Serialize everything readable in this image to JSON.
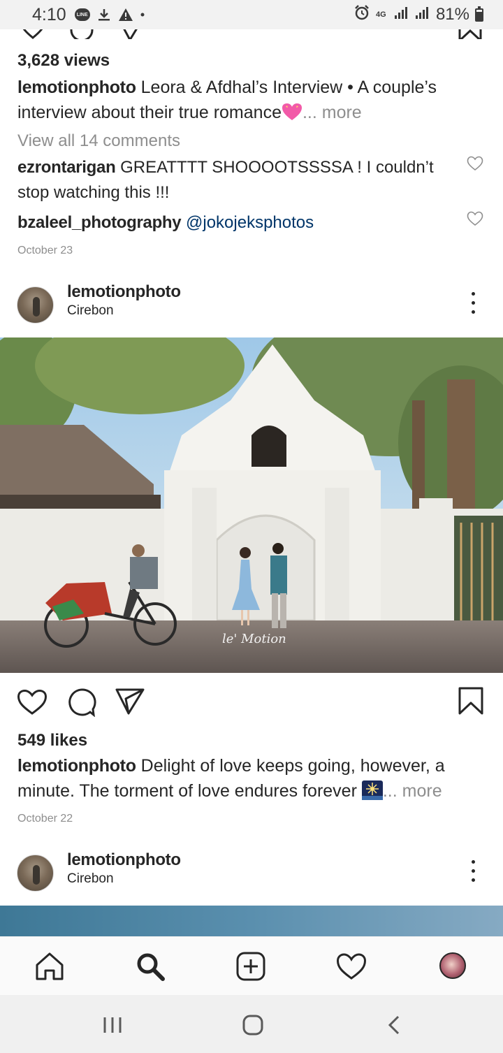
{
  "status_bar": {
    "time": "4:10",
    "left_icons": [
      "line-notification-icon",
      "download-icon",
      "warning-icon",
      "dot-icon"
    ],
    "right_icons": [
      "alarm-icon",
      "4g-icon",
      "signal-icon",
      "signal-icon",
      "battery-icon"
    ],
    "network": "4G",
    "battery_percent": "81%"
  },
  "post1": {
    "views": "3,628 views",
    "caption_user": "lemotionphoto",
    "caption_text": "Leora & Afdhal’s Interview • A couple’s interview about their true romance",
    "caption_more": "... more",
    "view_all_comments": "View all 14 comments",
    "comments": [
      {
        "user": "ezrontarigan",
        "text": "GREATTTT SHOOOOTSSSSA ! I couldn’t stop watching this !!!"
      },
      {
        "user": "bzaleel_photography",
        "mention": "@jokojeksphotos"
      }
    ],
    "date": "October 23"
  },
  "post2": {
    "username": "lemotionphoto",
    "location": "Cirebon",
    "watermark": "le' Motion",
    "likes": "549 likes",
    "caption_user": "lemotionphoto",
    "caption_text": "Delight of love keeps going, however, a minute. The torment of love endures forever",
    "caption_more": "... more",
    "date": "October 22"
  },
  "post3": {
    "username": "lemotionphoto",
    "location": "Cirebon"
  },
  "bottom_nav": {
    "items": [
      "home-icon",
      "search-icon",
      "new-post-icon",
      "activity-heart-icon",
      "profile-avatar"
    ],
    "active": "search-icon"
  },
  "system_nav": {
    "items": [
      "recent-apps-icon",
      "home-button-icon",
      "back-icon"
    ]
  }
}
